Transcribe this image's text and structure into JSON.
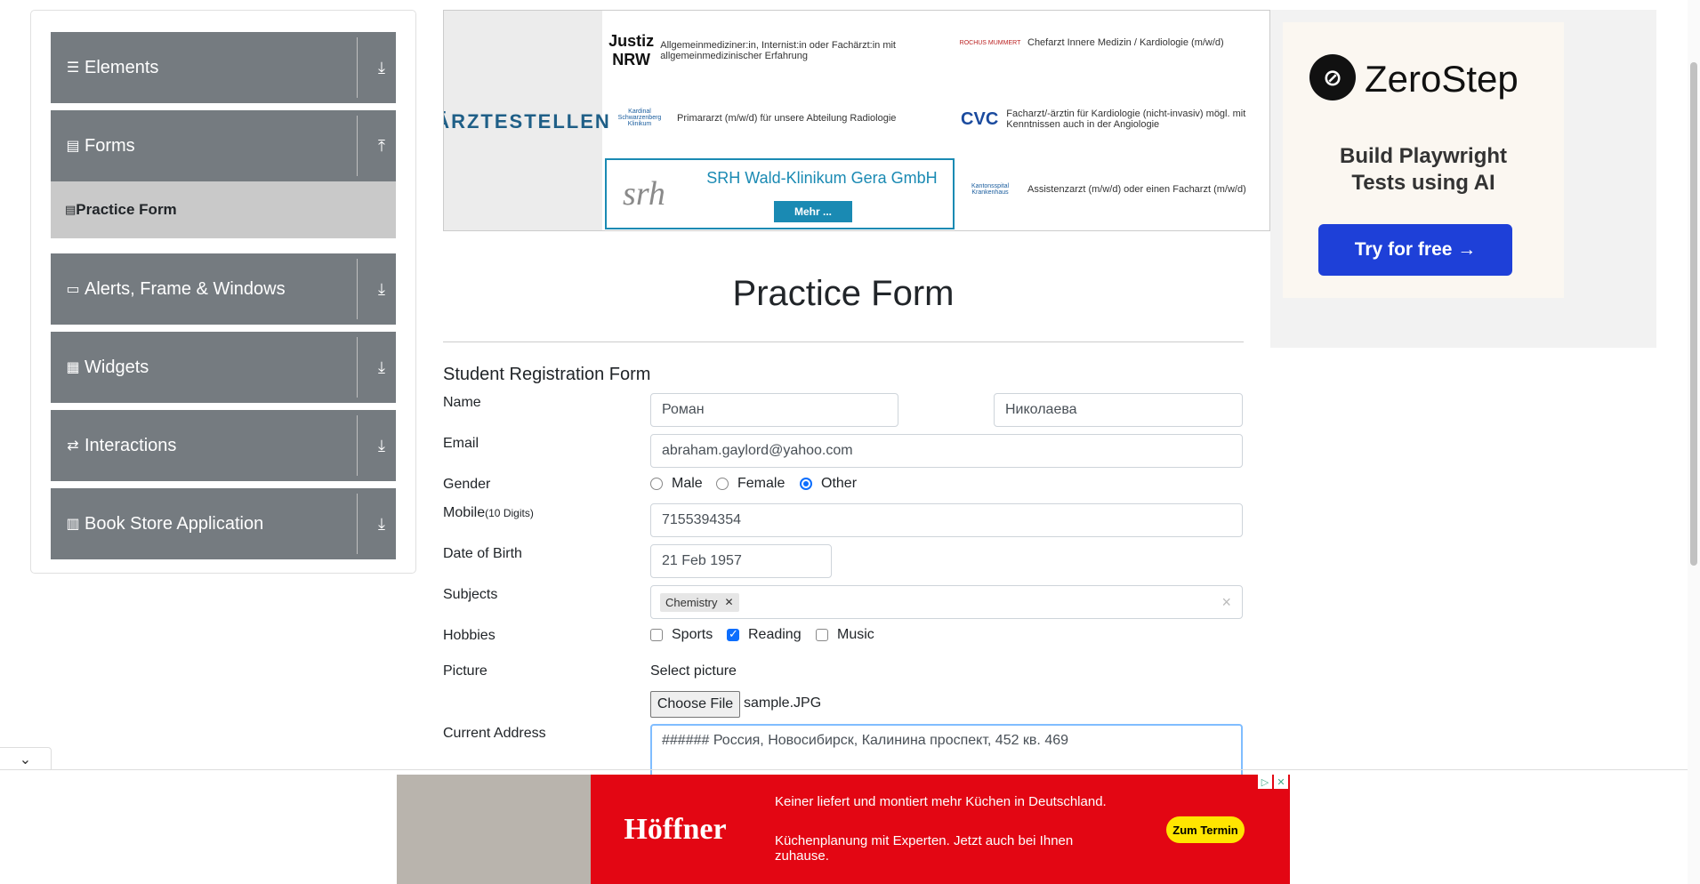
{
  "sidebar": {
    "groups": [
      {
        "label": "Elements",
        "icon": "hamburger-icon",
        "arrow": "download-arrow-icon"
      },
      {
        "label": "Forms",
        "icon": "document-icon",
        "arrow": "upload-arrow-icon"
      },
      {
        "label": "Alerts, Frame & Windows",
        "icon": "window-icon",
        "arrow": "download-arrow-icon"
      },
      {
        "label": "Widgets",
        "icon": "grid-icon",
        "arrow": "download-arrow-icon"
      },
      {
        "label": "Interactions",
        "icon": "interaction-icon",
        "arrow": "download-arrow-icon"
      },
      {
        "label": "Book Store Application",
        "icon": "books-icon",
        "arrow": "download-arrow-icon"
      }
    ],
    "active_item": "Practice Form"
  },
  "top_ad": {
    "brand": "ÄRZTESTELLEN",
    "jobs": [
      {
        "logo": "Justiz NRW",
        "text": "Allgemeinmediziner:in, Internist:in oder Fachärzt:in mit allgemeinmedizinischer Erfahrung"
      },
      {
        "logo": "ROCHUS MUMMERT",
        "text": "Chefarzt Innere Medizin / Kardiologie (m/w/d)"
      },
      {
        "logo": "Kardinal Schwarzenberg Klinikum",
        "text": "Primararzt (m/w/d) für unsere Abteilung Radiologie"
      },
      {
        "logo": "CVC",
        "text": "Facharzt/-ärztin für Kardiologie (nicht-invasiv) mögl. mit Kenntnissen auch in der Angiologie"
      },
      {
        "logo": "Kantonsspital Krankenhaus",
        "text": "Assistenzarzt (m/w/d) oder einen Facharzt (m/w/d)"
      }
    ],
    "featured": {
      "logo": "srh",
      "name": "SRH Wald-Klinikum Gera GmbH",
      "button": "Mehr ..."
    }
  },
  "right_ad": {
    "brand": "ZeroStep",
    "headline": "Build Playwright Tests using AI",
    "button": "Try for free →"
  },
  "form": {
    "page_title": "Practice Form",
    "form_title": "Student Registration Form",
    "labels": {
      "name": "Name",
      "email": "Email",
      "gender": "Gender",
      "mobile": "Mobile",
      "mobile_hint": "(10 Digits)",
      "dob": "Date of Birth",
      "subjects": "Subjects",
      "hobbies": "Hobbies",
      "picture": "Picture",
      "address": "Current Address"
    },
    "first_name": "Роман",
    "last_name": "Николаева",
    "email": "abraham.gaylord@yahoo.com",
    "gender_options": [
      "Male",
      "Female",
      "Other"
    ],
    "gender_selected": "Other",
    "mobile": "7155394354",
    "dob": "21 Feb 1957",
    "subjects": [
      "Chemistry"
    ],
    "subject_clear": "×",
    "hobby_options": [
      "Sports",
      "Reading",
      "Music"
    ],
    "hobbies_selected": [
      "Reading"
    ],
    "select_picture": "Select picture",
    "choose_file": "Choose File",
    "file_name": "sample.JPG",
    "address": "###### Россия, Новосибирск, Калинина проспект, 452 кв. 469"
  },
  "bottom_ad": {
    "brand": "Höffner",
    "line1": "Keiner liefert und montiert mehr Küchen in Deutschland.",
    "line2": "Küchenplanung mit Experten. Jetzt auch bei Ihnen zuhause.",
    "cta": "Zum Termin"
  }
}
